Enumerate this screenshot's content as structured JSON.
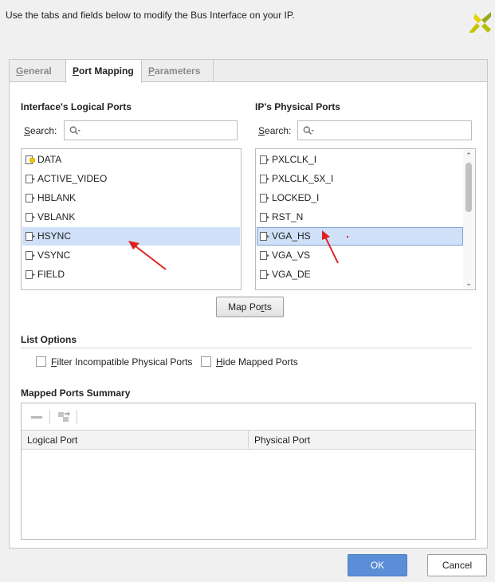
{
  "header": {
    "description": "Use the tabs and fields below to modify the Bus Interface on your IP."
  },
  "tabs": [
    {
      "label": "General",
      "mnemonic": "G",
      "rest": "eneral",
      "active": false
    },
    {
      "label": "Port Mapping",
      "mnemonic": "P",
      "rest": "ort Mapping",
      "active": true
    },
    {
      "label": "Parameters",
      "mnemonic": "P",
      "rest": "arameters",
      "active": false
    }
  ],
  "logical": {
    "title": "Interface's Logical Ports",
    "search_label_u": "S",
    "search_label_rest": "earch:",
    "search_value": "",
    "items": [
      {
        "label": "DATA",
        "icon": "folder-port-icon"
      },
      {
        "label": "ACTIVE_VIDEO",
        "icon": "port-icon"
      },
      {
        "label": "HBLANK",
        "icon": "port-icon"
      },
      {
        "label": "VBLANK",
        "icon": "port-icon"
      },
      {
        "label": "HSYNC",
        "icon": "port-icon",
        "selected": true
      },
      {
        "label": "VSYNC",
        "icon": "port-icon"
      },
      {
        "label": "FIELD",
        "icon": "port-icon"
      }
    ]
  },
  "physical": {
    "title": "IP's Physical Ports",
    "search_label_u": "S",
    "search_label_rest": "earch:",
    "search_value": "",
    "items": [
      {
        "label": "PXLCLK_I",
        "icon": "port-icon"
      },
      {
        "label": "PXLCLK_5X_I",
        "icon": "port-icon"
      },
      {
        "label": "LOCKED_I",
        "icon": "port-icon"
      },
      {
        "label": "RST_N",
        "icon": "port-icon"
      },
      {
        "label": "VGA_HS",
        "icon": "port-icon",
        "selected": true
      },
      {
        "label": "VGA_VS",
        "icon": "port-icon"
      },
      {
        "label": "VGA_DE",
        "icon": "port-icon"
      }
    ]
  },
  "map_ports": {
    "label_pre": "Map Po",
    "label_u": "r",
    "label_post": "ts"
  },
  "list_options": {
    "title": "List Options",
    "filter": {
      "u": "F",
      "rest": "ilter Incompatible Physical Ports",
      "checked": false
    },
    "hide": {
      "u": "H",
      "rest": "ide Mapped Ports",
      "checked": false
    }
  },
  "summary": {
    "title": "Mapped Ports Summary",
    "columns": [
      "Logical Port",
      "Physical Port"
    ],
    "rows": []
  },
  "footer": {
    "ok": "OK",
    "cancel": "Cancel"
  },
  "colors": {
    "accent": "#5a8fd8",
    "selection": "#cfe0f8",
    "annotation_arrow": "#e02020"
  }
}
